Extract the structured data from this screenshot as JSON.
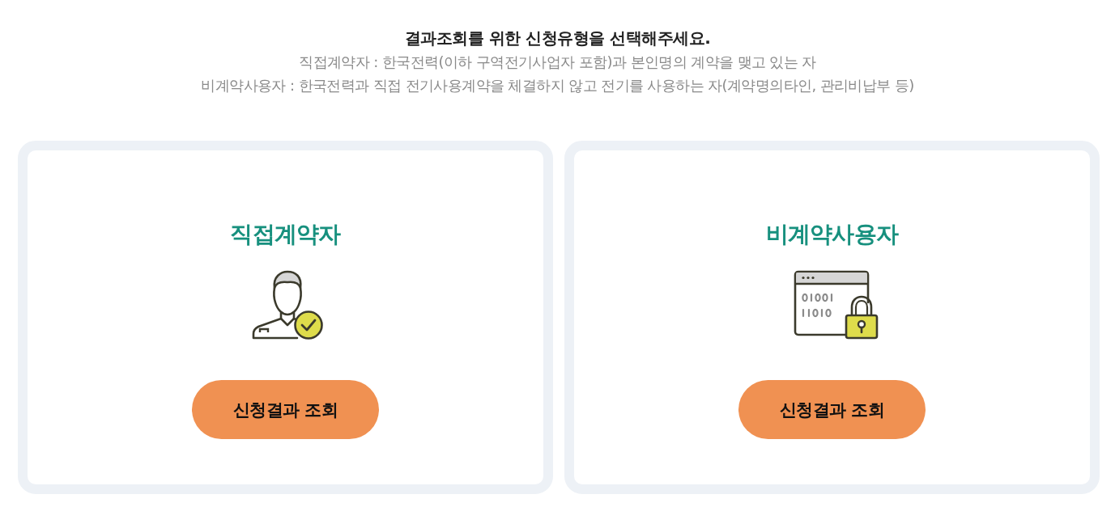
{
  "header": {
    "title": "결과조회를 위한 신청유형을 선택해주세요.",
    "notes": [
      "직접계약자 : 한국전력(이하 구역전기사업자 포함)과 본인명의 계약을 맺고 있는 자",
      "비계약사용자 : 한국전력과 직접 전기사용계약을 체결하지 않고 전기를 사용하는 자(계약명의타인, 관리비납부 등)"
    ]
  },
  "cards": [
    {
      "title": "직접계약자",
      "kind": "person",
      "button": "신청결과 조회"
    },
    {
      "title": "비계약사용자",
      "kind": "lock",
      "button": "신청결과 조회"
    }
  ]
}
